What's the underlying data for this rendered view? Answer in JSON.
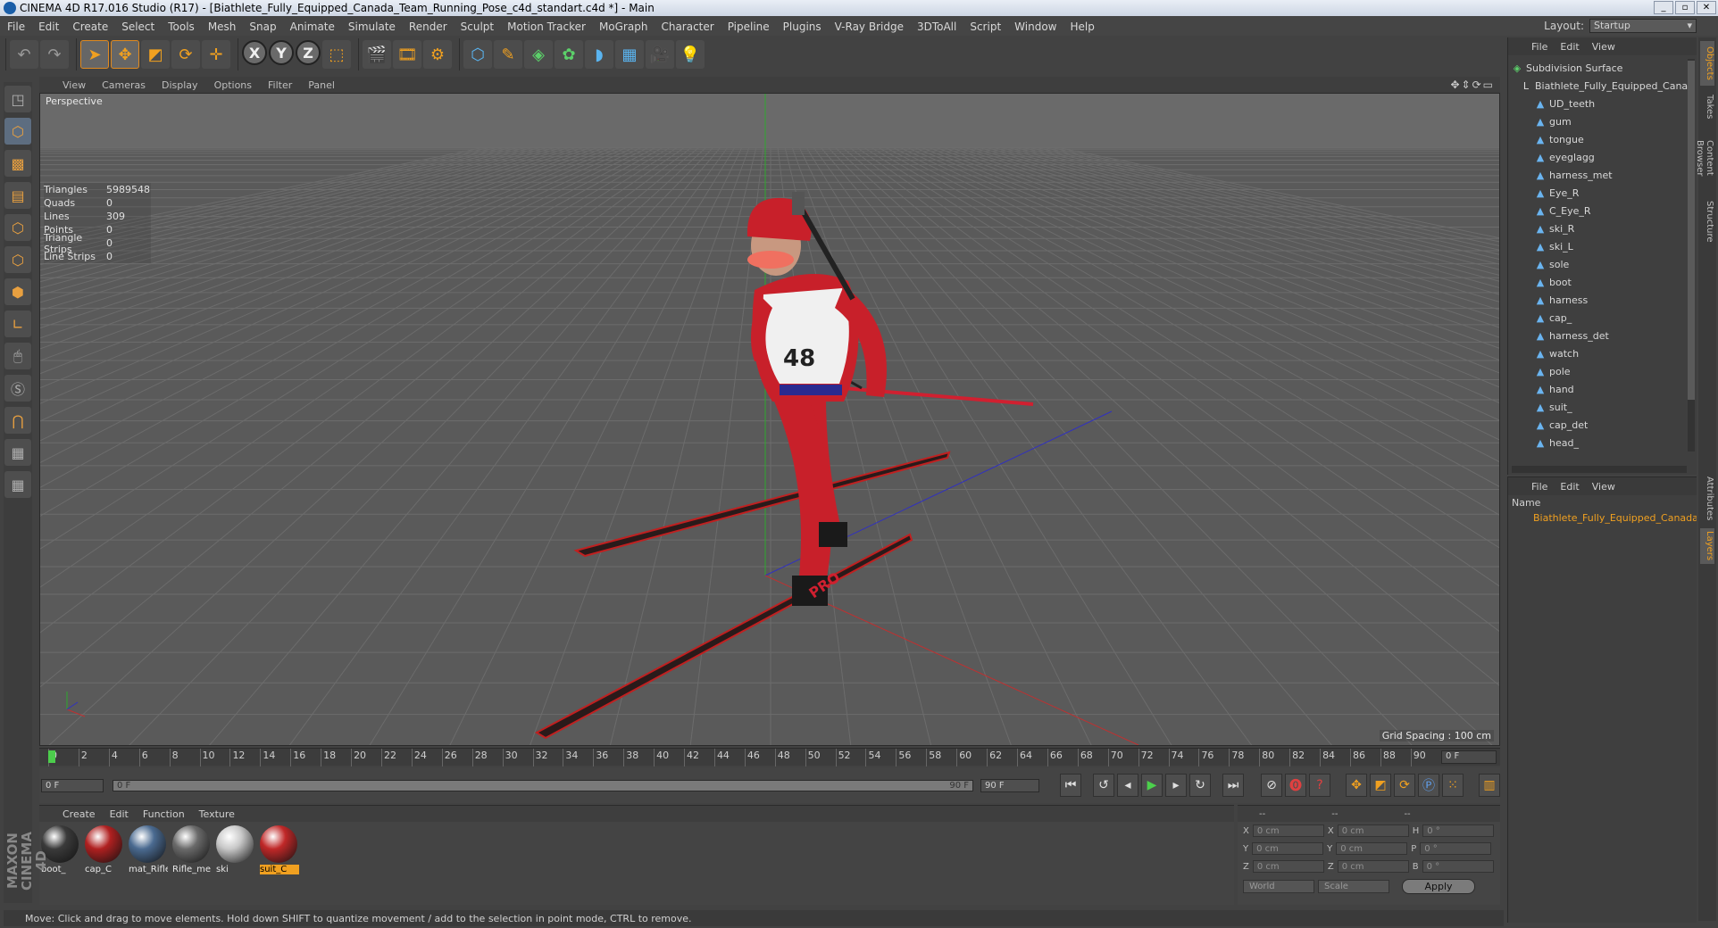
{
  "window": {
    "title": "CINEMA 4D R17.016 Studio (R17) - [Biathlete_Fully_Equipped_Canada_Team_Running_Pose_c4d_standart.c4d *] - Main",
    "controls": [
      "_",
      "▫",
      "✕"
    ]
  },
  "menu": [
    "File",
    "Edit",
    "Create",
    "Select",
    "Tools",
    "Mesh",
    "Snap",
    "Animate",
    "Simulate",
    "Render",
    "Sculpt",
    "Motion Tracker",
    "MoGraph",
    "Character",
    "Pipeline",
    "Plugins",
    "V-Ray Bridge",
    "3DToAll",
    "Script",
    "Window",
    "Help"
  ],
  "layout": {
    "label": "Layout:",
    "value": "Startup"
  },
  "viewport": {
    "menu": [
      "View",
      "Cameras",
      "Display",
      "Options",
      "Filter",
      "Panel"
    ],
    "label": "Perspective",
    "stats": [
      {
        "k": "Triangles",
        "v": "5989548"
      },
      {
        "k": "Quads",
        "v": "0"
      },
      {
        "k": "Lines",
        "v": "309"
      },
      {
        "k": "Points",
        "v": "0"
      },
      {
        "k": "Triangle Strips",
        "v": "0"
      },
      {
        "k": "Line Strips",
        "v": "0"
      }
    ],
    "grid_spacing": "Grid Spacing : 100 cm",
    "bib_number": "48",
    "ski_brand": "PRO"
  },
  "timeline": {
    "ticks": [
      "0",
      "2",
      "4",
      "6",
      "8",
      "10",
      "12",
      "14",
      "16",
      "18",
      "20",
      "22",
      "24",
      "26",
      "28",
      "30",
      "32",
      "34",
      "36",
      "38",
      "40",
      "42",
      "44",
      "46",
      "48",
      "50",
      "52",
      "54",
      "56",
      "58",
      "60",
      "62",
      "64",
      "66",
      "68",
      "70",
      "72",
      "74",
      "76",
      "78",
      "80",
      "82",
      "84",
      "86",
      "88",
      "90"
    ],
    "current": "0 F"
  },
  "transport": {
    "start": "0 F",
    "range_start": "0 F",
    "range_end": "90 F",
    "end": "90 F"
  },
  "materials": {
    "menu": [
      "Create",
      "Edit",
      "Function",
      "Texture"
    ],
    "items": [
      {
        "name": "boot_",
        "color": "#3a3a3a"
      },
      {
        "name": "cap_C",
        "color": "#b02020"
      },
      {
        "name": "mat_Rifle",
        "color": "#4a6a90"
      },
      {
        "name": "Rifle_me",
        "color": "#6a6a6a"
      },
      {
        "name": "ski",
        "color": "#c8c8c8"
      },
      {
        "name": "suit_C",
        "color": "#c02828"
      }
    ]
  },
  "coords": {
    "headers": [
      "--",
      "--",
      "--"
    ],
    "rows": [
      {
        "a": "X",
        "av": "0 cm",
        "b": "X",
        "bv": "0 cm",
        "c": "H",
        "cv": "0 °"
      },
      {
        "a": "Y",
        "av": "0 cm",
        "b": "Y",
        "bv": "0 cm",
        "c": "P",
        "cv": "0 °"
      },
      {
        "a": "Z",
        "av": "0 cm",
        "b": "Z",
        "bv": "0 cm",
        "c": "B",
        "cv": "0 °"
      }
    ],
    "mode": "World",
    "transform": "Scale",
    "apply": "Apply"
  },
  "status": "Move: Click and drag to move elements. Hold down SHIFT to quantize movement / add to the selection in point mode, CTRL to remove.",
  "objects": {
    "menu": [
      "File",
      "Edit",
      "View"
    ],
    "root": "Subdivision Surface",
    "group": "Biathlete_Fully_Equipped_Canad",
    "children": [
      "UD_teeth",
      "gum",
      "tongue",
      "eyeglagg",
      "harness_met",
      "Eye_R",
      "C_Eye_R",
      "ski_R",
      "ski_L",
      "sole",
      "boot",
      "harness",
      "cap_",
      "harness_det",
      "watch",
      "pole",
      "hand",
      "suit_",
      "cap_det",
      "head_"
    ]
  },
  "layers": {
    "menu": [
      "File",
      "Edit",
      "View"
    ],
    "header": "Name",
    "item": "Biathlete_Fully_Equipped_Canada_T"
  },
  "side_tabs": [
    "Objects",
    "Takes",
    "Content Browser",
    "Structure",
    "Attributes",
    "Layers"
  ],
  "brand": "MAXON CINEMA 4D",
  "colors": {
    "accent": "#f0a020",
    "viewport_bg": "#5c5c5c",
    "suit_red": "#c8202a"
  }
}
